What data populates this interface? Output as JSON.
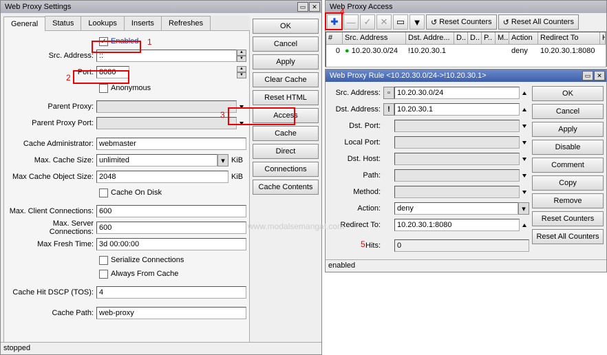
{
  "settings": {
    "title": "Web Proxy Settings",
    "tabs": [
      "General",
      "Status",
      "Lookups",
      "Inserts",
      "Refreshes"
    ],
    "enabled_label": "Enabled",
    "labels": {
      "src_addr": "Src. Address:",
      "port": "Port:",
      "anonymous": "Anonymous",
      "parent_proxy": "Parent Proxy:",
      "parent_port": "Parent Proxy Port:",
      "cache_admin": "Cache Administrator:",
      "max_cache": "Max. Cache Size:",
      "max_obj": "Max Cache Object Size:",
      "cache_disk": "Cache On Disk",
      "max_client": "Max. Client Connections:",
      "max_server": "Max. Server Connections:",
      "max_fresh": "Max Fresh Time:",
      "serialize": "Serialize Connections",
      "always": "Always From Cache",
      "dscp": "Cache Hit DSCP (TOS):",
      "cache_path": "Cache Path:"
    },
    "values": {
      "src_addr": "::",
      "port": "8080",
      "parent_proxy": "",
      "parent_port": "",
      "cache_admin": "webmaster",
      "max_cache": "unlimited",
      "max_obj": "2048",
      "max_client": "600",
      "max_server": "600",
      "max_fresh": "3d 00:00:00",
      "dscp": "4",
      "cache_path": "web-proxy"
    },
    "unit_kib": "KiB",
    "buttons": [
      "OK",
      "Cancel",
      "Apply",
      "Clear Cache",
      "Reset HTML",
      "Access",
      "Cache",
      "Direct",
      "Connections",
      "Cache Contents"
    ],
    "status": "stopped"
  },
  "access": {
    "title": "Web Proxy Access",
    "btn_reset": "Reset Counters",
    "btn_reset_all": "Reset All Counters",
    "cols": {
      "num": "#",
      "src": "Src. Address",
      "dst": "Dst. Addre...",
      "d1": "D..",
      "d2": "D..",
      "p": "P..",
      "m": "M..",
      "act": "Action",
      "redir": "Redirect To",
      "hits": "Hits"
    },
    "row": {
      "num": "0",
      "src": "10.20.30.0/24",
      "dst": "!10.20.30.1",
      "act": "deny",
      "redir": "10.20.30.1:8080"
    }
  },
  "rule": {
    "title": "Web Proxy Rule <10.20.30.0/24->!10.20.30.1>",
    "labels": {
      "src": "Src. Address:",
      "dst": "Dst. Address:",
      "dport": "Dst. Port:",
      "lport": "Local Port:",
      "dhost": "Dst. Host:",
      "path": "Path:",
      "method": "Method:",
      "action": "Action:",
      "redir": "Redirect To:",
      "hits": "Hits:"
    },
    "values": {
      "src": "10.20.30.0/24",
      "dst": "10.20.30.1",
      "dport": "",
      "lport": "",
      "dhost": "",
      "path": "",
      "method": "",
      "action": "deny",
      "redir": "10.20.30.1:8080",
      "hits": "0"
    },
    "buttons": [
      "OK",
      "Cancel",
      "Apply",
      "Disable",
      "Comment",
      "Copy",
      "Remove",
      "Reset Counters",
      "Reset All Counters"
    ],
    "status": "enabled"
  },
  "annotations": {
    "a1": "1",
    "a2": "2",
    "a3": "3",
    "a4": "4",
    "a5": "5"
  },
  "watermark": "www.modalsemangat.com"
}
